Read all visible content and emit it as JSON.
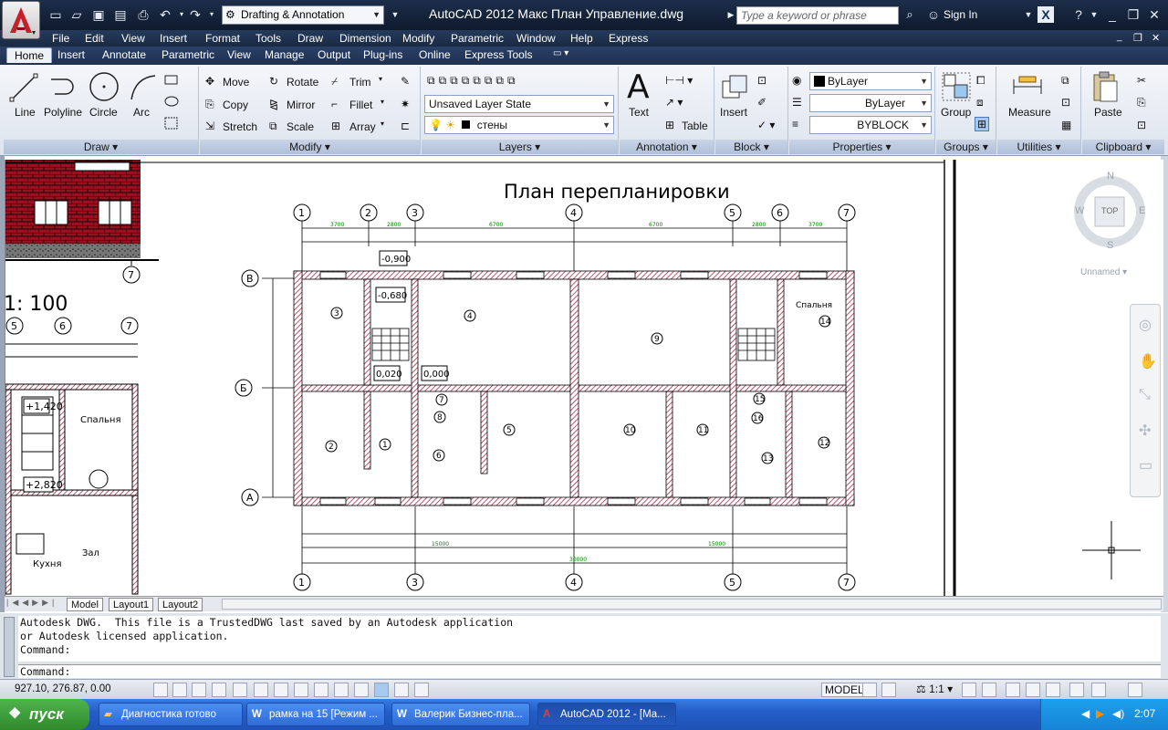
{
  "titlebar": {
    "workspace": "Drafting & Annotation",
    "title": "AutoCAD 2012    Макс План Управление.dwg",
    "search_placeholder": "Type a keyword or phrase",
    "sign_in": "Sign In"
  },
  "menu": [
    "File",
    "Edit",
    "View",
    "Insert",
    "Format",
    "Tools",
    "Draw",
    "Dimension",
    "Modify",
    "Parametric",
    "Window",
    "Help",
    "Express"
  ],
  "ribbon_tabs": [
    "Home",
    "Insert",
    "Annotate",
    "Parametric",
    "View",
    "Manage",
    "Output",
    "Plug-ins",
    "Online",
    "Express Tools"
  ],
  "ribbon": {
    "draw": {
      "title": "Draw",
      "line": "Line",
      "polyline": "Polyline",
      "circle": "Circle",
      "arc": "Arc"
    },
    "modify": {
      "title": "Modify",
      "move": "Move",
      "rotate": "Rotate",
      "trim": "Trim",
      "copy": "Copy",
      "mirror": "Mirror",
      "fillet": "Fillet",
      "stretch": "Stretch",
      "scale": "Scale",
      "array": "Array"
    },
    "layers": {
      "title": "Layers",
      "layer_state": "Unsaved Layer State",
      "current_layer": "стены"
    },
    "annotation": {
      "title": "Annotation",
      "text": "Text",
      "table": "Table"
    },
    "block": {
      "title": "Block",
      "insert": "Insert"
    },
    "properties": {
      "title": "Properties",
      "color": "ByLayer",
      "linetype": "ByLayer",
      "lineweight": "BYBLOCK"
    },
    "groups": {
      "title": "Groups",
      "group": "Group"
    },
    "utilities": {
      "title": "Utilities",
      "measure": "Measure"
    },
    "clipboard": {
      "title": "Clipboard",
      "paste": "Paste"
    }
  },
  "drawing": {
    "plan_title": "План перепланировки",
    "scale_text": "1: 100",
    "bedroom_label": "Спальня",
    "bedroom_label2": "Спальня",
    "hall_label": "Зал",
    "kitchen_label": "Кухня",
    "level_marks": [
      "-0,900",
      "-0,680",
      "0,020",
      "0,000",
      "+1,420",
      "+2,820"
    ],
    "axis_top": [
      "1",
      "2",
      "3",
      "4",
      "5",
      "6",
      "7"
    ],
    "axis_bottom": [
      "1",
      "3",
      "4",
      "5",
      "7"
    ],
    "axis_left": [
      "В",
      "Б",
      "А"
    ],
    "axis_left_plan": [
      "5",
      "6",
      "7"
    ],
    "rooms": [
      "3",
      "4",
      "9",
      "14",
      "7",
      "8",
      "6",
      "2",
      "1",
      "5",
      "10",
      "11",
      "15",
      "16",
      "13",
      "12"
    ],
    "top_dims": [
      "3700",
      "2800",
      "6700",
      "6700",
      "2800",
      "3700"
    ],
    "total_dim": "30000",
    "half_dims": [
      "15000",
      "15000"
    ]
  },
  "viewcube": {
    "n": "N",
    "s": "S",
    "e": "E",
    "w": "W",
    "top": "TOP",
    "ucs": "Unnamed"
  },
  "layout_tabs": [
    "Model",
    "Layout1",
    "Layout2"
  ],
  "command": {
    "line1": "Autodesk DWG.  This file is a TrustedDWG last saved by an Autodesk application",
    "line2": "or Autodesk licensed application.",
    "line3": "Command:",
    "prompt": "Command:"
  },
  "status": {
    "coords": "927.10, 276.87, 0.00",
    "model": "MODEL",
    "scale": "1:1"
  },
  "taskbar": {
    "start": "пуск",
    "tasks": [
      "Диагностика готово",
      "рамка на 15 [Режим ...",
      "Валерик Бизнес-пла...",
      "AutoCAD 2012 - [Ma..."
    ],
    "lang": "RU",
    "clock": "2:07"
  }
}
